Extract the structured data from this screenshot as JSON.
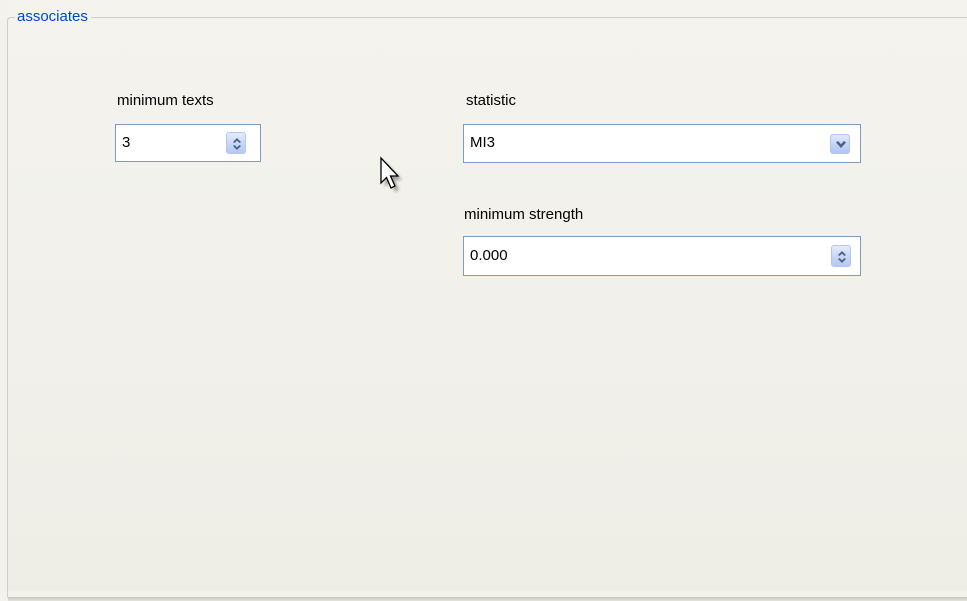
{
  "group": {
    "title": "associates"
  },
  "minimum_texts": {
    "label": "minimum texts",
    "value": "3"
  },
  "statistic": {
    "label": "statistic",
    "selected": "MI3"
  },
  "minimum_strength": {
    "label": "minimum strength",
    "value": "0.000"
  },
  "icons": {
    "spinner": "up-down-arrows-icon",
    "dropdown": "chevron-down-icon",
    "cursor": "mouse-pointer-icon"
  },
  "colors": {
    "legend": "#0046d5",
    "field_border": "#7f9db9",
    "button_arrow": "#4d6185"
  }
}
